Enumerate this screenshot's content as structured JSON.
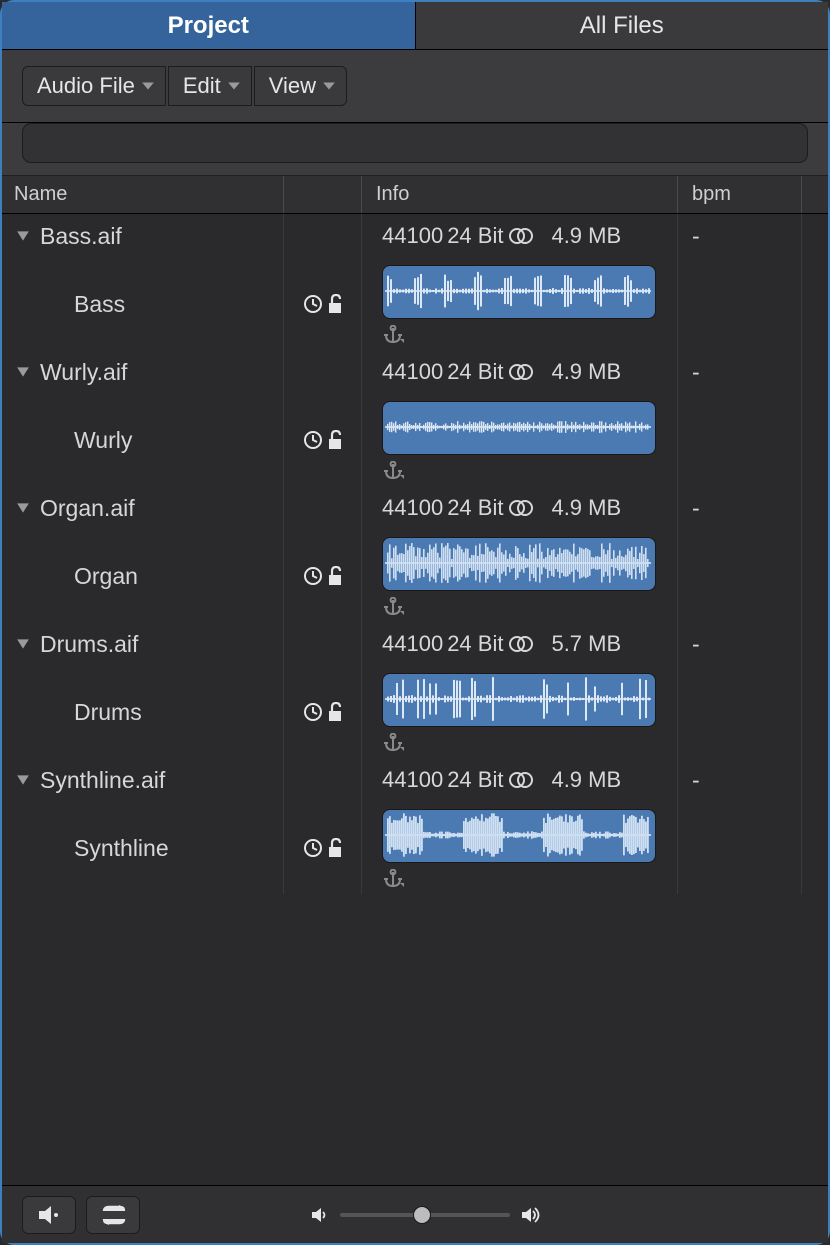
{
  "tabs": {
    "project": "Project",
    "all_files": "All Files"
  },
  "toolbar": {
    "audio_file": "Audio File",
    "edit": "Edit",
    "view": "View"
  },
  "columns": {
    "name": "Name",
    "info": "Info",
    "bpm": "bpm"
  },
  "info_shared": {
    "sample_rate": "44100",
    "bit_depth": "24 Bit"
  },
  "files": [
    {
      "file": "Bass.aif",
      "region": "Bass",
      "size": "4.9 MB",
      "bpm": "-",
      "wave": "sparse"
    },
    {
      "file": "Wurly.aif",
      "region": "Wurly",
      "size": "4.9 MB",
      "bpm": "-",
      "wave": "fine"
    },
    {
      "file": "Organ.aif",
      "region": "Organ",
      "size": "4.9 MB",
      "bpm": "-",
      "wave": "dense"
    },
    {
      "file": "Drums.aif",
      "region": "Drums",
      "size": "5.7 MB",
      "bpm": "-",
      "wave": "transient"
    },
    {
      "file": "Synthline.aif",
      "region": "Synthline",
      "size": "4.9 MB",
      "bpm": "-",
      "wave": "blocks"
    }
  ]
}
